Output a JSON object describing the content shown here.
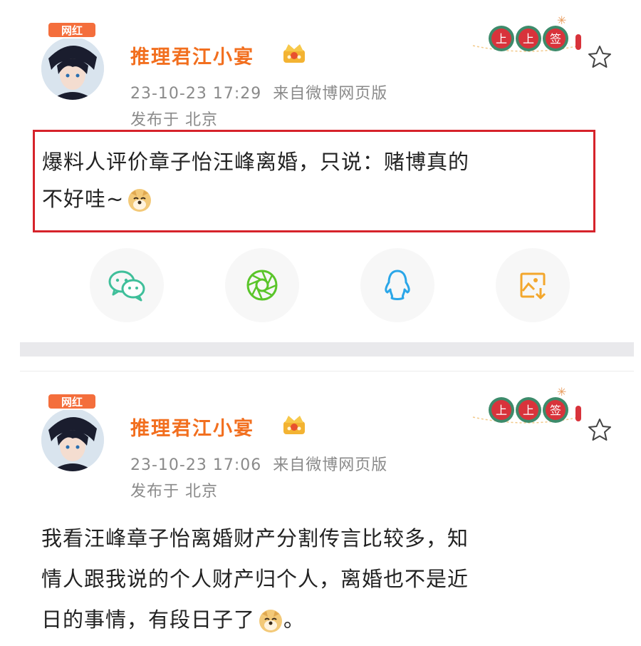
{
  "posts": [
    {
      "badge": "网红",
      "username": "推理君江小宴",
      "time": "23-10-23 17:29",
      "source": "来自微博网页版",
      "location": "发布于 北京",
      "content_lines": [
        "爆料人评价章子怡汪峰离婚，只说：赌博真的",
        "不好哇~"
      ],
      "deco_tags": [
        "上",
        "上",
        "签"
      ]
    },
    {
      "badge": "网红",
      "username": "推理君江小宴",
      "time": "23-10-23 17:06",
      "source": "来自微博网页版",
      "location": "发布于 北京",
      "content_lines": [
        "我看汪峰章子怡离婚财产分割传言比较多，知",
        "情人跟我说的个人财产归个人，离婚也不是近",
        "日的事情，有段日子了",
        "。"
      ],
      "deco_tags": [
        "上",
        "上",
        "签"
      ]
    }
  ],
  "share_icons": [
    "wechat-icon",
    "moments-icon",
    "qq-icon",
    "save-image-icon"
  ],
  "colors": {
    "username": "#f26f1f",
    "highlight_border": "#d6232b",
    "badge": "#f46e3c",
    "deco_red": "#d8333b",
    "deco_green": "#3d8b6b"
  }
}
